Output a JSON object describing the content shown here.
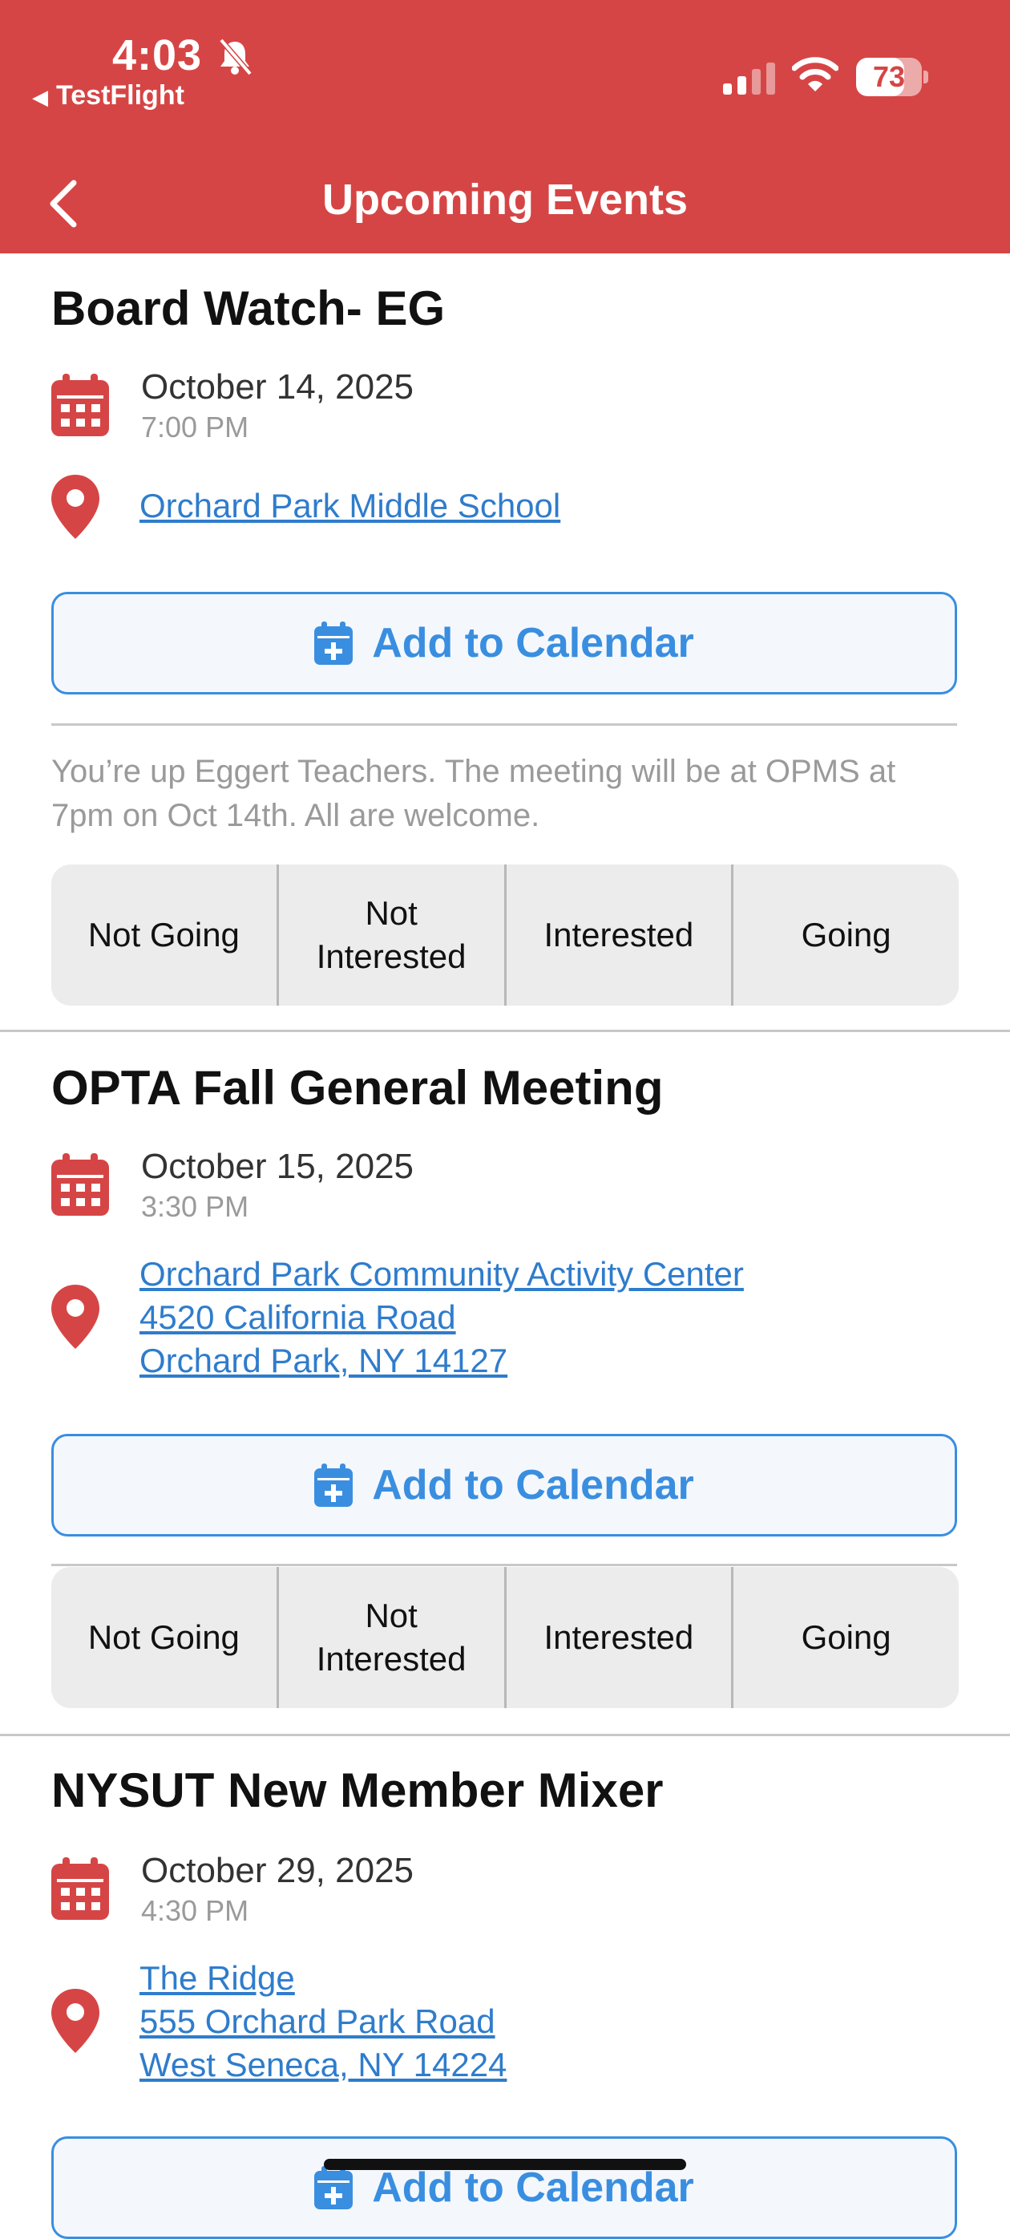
{
  "status_bar": {
    "time": "4:03",
    "back_app": "TestFlight",
    "battery": "73",
    "battery_level": 0.73
  },
  "nav": {
    "title": "Upcoming Events"
  },
  "colors": {
    "header": "#d64545",
    "accent": "#3a8ee0",
    "link": "#2f7ccc"
  },
  "events": [
    {
      "title": "Board Watch- EG",
      "date": "October 14, 2025",
      "time": "7:00 PM",
      "location": [
        "Orchard Park Middle School"
      ],
      "add_to_calendar": "Add to Calendar",
      "description": "You’re up Eggert Teachers.  The meeting will be at OPMS at 7pm on Oct 14th. All are welcome.",
      "rsvp": [
        "Not Going",
        "Not Interested",
        "Interested",
        "Going"
      ]
    },
    {
      "title": "OPTA Fall General Meeting",
      "date": "October 15, 2025",
      "time": "3:30 PM",
      "location": [
        "Orchard Park Community Activity Center",
        "4520 California Road",
        "Orchard Park, NY 14127"
      ],
      "add_to_calendar": "Add to Calendar",
      "rsvp": [
        "Not Going",
        "Not Interested",
        "Interested",
        "Going"
      ]
    },
    {
      "title": "NYSUT New Member Mixer",
      "date": "October 29, 2025",
      "time": "4:30 PM",
      "location": [
        "The Ridge",
        "555 Orchard Park Road",
        "West Seneca, NY 14224"
      ],
      "add_to_calendar": "Add to Calendar"
    }
  ],
  "icons": {
    "calendar": "calendar-icon",
    "pin": "location-pin-icon",
    "add_calendar": "calendar-plus-icon",
    "back": "chevron-left-icon",
    "bell": "bell-slash-icon"
  }
}
